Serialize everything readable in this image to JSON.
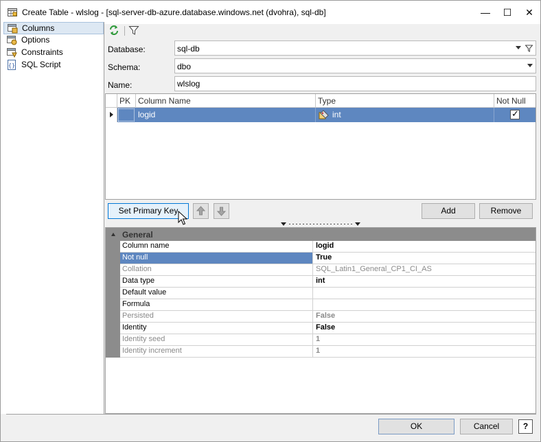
{
  "window": {
    "title": "Create Table - wlslog - [sql-server-db-azure.database.windows.net (dvohra), sql-db]",
    "minimize_glyph": "—",
    "maximize_glyph": "☐",
    "close_glyph": "✕"
  },
  "nav": {
    "items": [
      {
        "label": "Columns",
        "icon": "table-columns-icon",
        "selected": true
      },
      {
        "label": "Options",
        "icon": "options-icon",
        "selected": false
      },
      {
        "label": "Constraints",
        "icon": "constraints-icon",
        "selected": false
      },
      {
        "label": "SQL Script",
        "icon": "sql-script-icon",
        "selected": false
      }
    ]
  },
  "toolbar": {
    "refresh_icon": "refresh-icon",
    "filter_icon": "filter-icon"
  },
  "form": {
    "database_label": "Database:",
    "database_value": "sql-db",
    "schema_label": "Schema:",
    "schema_value": "dbo",
    "name_label": "Name:",
    "name_value": "wlslog"
  },
  "grid": {
    "headers": {
      "pk": "PK",
      "column_name": "Column Name",
      "type": "Type",
      "not_null": "Not Null"
    },
    "rows": [
      {
        "pk": "",
        "column_name": "logid",
        "type": "int",
        "not_null": true
      }
    ]
  },
  "buttons": {
    "set_primary_key": "Set Primary Key",
    "add": "Add",
    "remove": "Remove",
    "ok": "OK",
    "cancel": "Cancel",
    "help": "?"
  },
  "properties": {
    "category": "General",
    "rows": [
      {
        "name": "Column name",
        "value": "logid",
        "bold": true,
        "dim": false,
        "selected": false
      },
      {
        "name": "Not null",
        "value": "True",
        "bold": true,
        "dim": false,
        "selected": true
      },
      {
        "name": "Collation",
        "value": "SQL_Latin1_General_CP1_CI_AS",
        "bold": false,
        "dim": true,
        "selected": false
      },
      {
        "name": "Data type",
        "value": "int",
        "bold": true,
        "dim": false,
        "selected": false
      },
      {
        "name": "Default value",
        "value": "",
        "bold": false,
        "dim": false,
        "selected": false
      },
      {
        "name": "Formula",
        "value": "",
        "bold": false,
        "dim": false,
        "selected": false
      },
      {
        "name": "Persisted",
        "value": "False",
        "bold": true,
        "dim": true,
        "selected": false
      },
      {
        "name": "Identity",
        "value": "False",
        "bold": true,
        "dim": false,
        "selected": false
      },
      {
        "name": "Identity seed",
        "value": "1",
        "bold": true,
        "dim": true,
        "selected": false
      },
      {
        "name": "Identity increment",
        "value": "1",
        "bold": true,
        "dim": true,
        "selected": false
      }
    ]
  },
  "colors": {
    "selection": "#5e87c0",
    "category_bar": "#8c8c8c",
    "nav_selected": "#dde8f3",
    "dim_text": "#8a8a8a"
  }
}
